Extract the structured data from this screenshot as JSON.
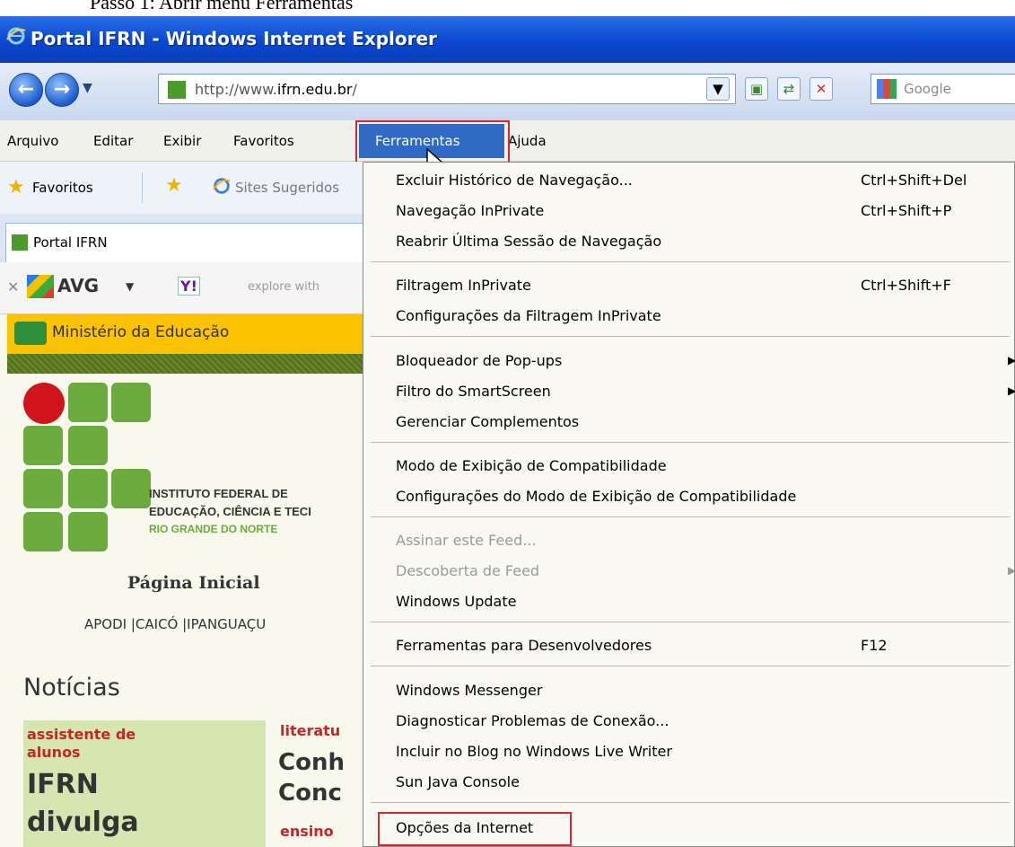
{
  "caption": "Passo 1: Abrir menu Ferramentas",
  "window": {
    "title": "Portal IFRN - Windows Internet Explorer"
  },
  "address": {
    "prefix": "http://www.",
    "domain": "ifrn.edu.br",
    "suffix": "/",
    "search_placeholder": "Google"
  },
  "menubar": [
    "Arquivo",
    "Editar",
    "Exibir",
    "Favoritos",
    "Ferramentas",
    "Ajuda"
  ],
  "favbar": {
    "favoritos": "Favoritos",
    "sites": "Sites Sugeridos"
  },
  "tab": {
    "label": "Portal IFRN"
  },
  "avg": {
    "brand": "AVG",
    "yahoo": "Y!",
    "search": "explore with"
  },
  "page": {
    "ministerio": "Ministério da Educação",
    "inst1": "INSTITUTO FEDERAL DE",
    "inst2": "EDUCAÇÃO, CIÊNCIA E TECI",
    "inst3": "RIO GRANDE DO NORTE",
    "home": "Página Inicial",
    "campi": "APODI |CAICÓ |IPANGUAÇU",
    "noticias": "Notícias",
    "n1a": "assistente de",
    "n1b": "alunos",
    "n2a": "IFRN",
    "n2b": "divulga",
    "n3": "literatu",
    "n4": "Conh",
    "n5": "Conc",
    "n6": "ensino"
  },
  "menu": {
    "items": [
      {
        "label": "Excluir Histórico de Navegação...",
        "shortcut": "Ctrl+Shift+Del"
      },
      {
        "label": "Navegação InPrivate",
        "shortcut": "Ctrl+Shift+P"
      },
      {
        "label": "Reabrir Última Sessão de Navegação",
        "shortcut": ""
      },
      {
        "label": "Filtragem InPrivate",
        "shortcut": "Ctrl+Shift+F"
      },
      {
        "label": "Configurações da Filtragem InPrivate",
        "shortcut": ""
      },
      {
        "label": "Bloqueador de Pop-ups",
        "shortcut": ""
      },
      {
        "label": "Filtro do SmartScreen",
        "shortcut": ""
      },
      {
        "label": "Gerenciar Complementos",
        "shortcut": ""
      },
      {
        "label": "Modo de Exibição de Compatibilidade",
        "shortcut": ""
      },
      {
        "label": "Configurações do Modo de Exibição de Compatibilidade",
        "shortcut": ""
      },
      {
        "label": "Assinar este Feed...",
        "shortcut": ""
      },
      {
        "label": "Descoberta de Feed",
        "shortcut": ""
      },
      {
        "label": "Windows Update",
        "shortcut": ""
      },
      {
        "label": "Ferramentas para Desenvolvedores",
        "shortcut": "F12"
      },
      {
        "label": "Windows Messenger",
        "shortcut": ""
      },
      {
        "label": "Diagnosticar Problemas de Conexão...",
        "shortcut": ""
      },
      {
        "label": "Incluir no Blog no Windows Live Writer",
        "shortcut": ""
      },
      {
        "label": "Sun Java Console",
        "shortcut": ""
      },
      {
        "label": "Opções da Internet",
        "shortcut": ""
      }
    ]
  }
}
